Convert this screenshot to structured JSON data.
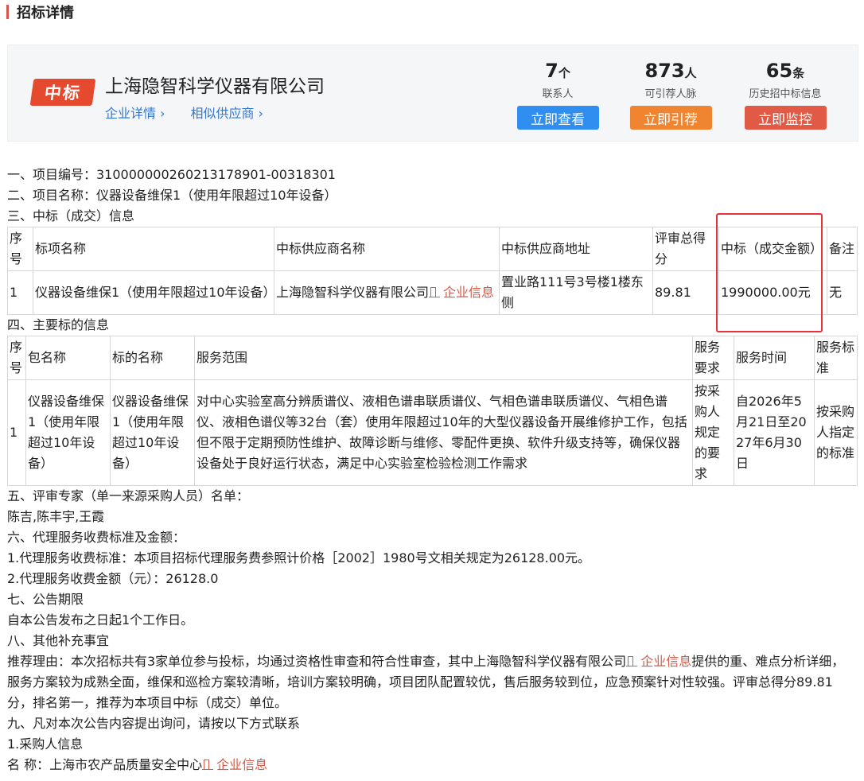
{
  "header": {
    "title": "招标详情"
  },
  "card": {
    "badge": "中标",
    "company": "上海隐智科学仪器有限公司",
    "links": [
      "企业详情 ›",
      "相似供应商 ›"
    ],
    "stats": [
      {
        "value": "7",
        "unit": "个",
        "label": "联系人",
        "button": "立即查看",
        "color": "#2f8ef0"
      },
      {
        "value": "873",
        "unit": "人",
        "label": "可引荐人脉",
        "button": "立即引荐",
        "color": "#ef8431"
      },
      {
        "value": "65",
        "unit": "条",
        "label": "历史招中标信息",
        "button": "立即监控",
        "color": "#e05a45"
      }
    ]
  },
  "body": {
    "s1": "一、项目编号：310000000260213178901-00318301",
    "s2": "二、项目名称：仪器设备维保1（使用年限超过10年设备）",
    "s3": "三、中标（成交）信息",
    "t1": {
      "headers": [
        "序号",
        "标项名称",
        "中标供应商名称",
        "中标供应商地址",
        "评审总得分",
        "中标（成交金额）",
        "备注"
      ],
      "row": {
        "no": "1",
        "name": "仪器设备维保1（使用年限超过10年设备）",
        "supplier": "上海隐智科学仪器有限公司",
        "supplier_link": "企业信息",
        "address": "置业路111号3号楼1楼东侧",
        "score": "89.81",
        "amount": "1990000.00元",
        "remark": "无"
      }
    },
    "s4": "四、主要标的信息",
    "t2": {
      "headers": [
        "序号",
        "包名称",
        "标的名称",
        "服务范围",
        "服务要求",
        "服务时间",
        "服务标准"
      ],
      "row": {
        "no": "1",
        "pkg": "仪器设备维保1（使用年限超过10年设备）",
        "target": "仪器设备维保1（使用年限超过10年设备）",
        "scope": "对中心实验室高分辨质谱仪、液相色谱串联质谱仪、气相色谱串联质谱仪、气相色谱仪、液相色谱仪等32台（套）使用年限超过10年的大型仪器设备开展维修护工作，包括但不限于定期预防性维护、故障诊断与维修、零配件更换、软件升级支持等，确保仪器设备处于良好运行状态，满足中心实验室检验检测工作需求",
        "req": "按采购人规定的要求",
        "time": "自2026年5月21日至2027年6月30日",
        "std": "按采购人指定的标准"
      }
    },
    "s5": "五、评审专家（单一来源采购人员）名单：",
    "experts": "陈吉,陈丰宇,王霞",
    "s6": "六、代理服务收费标准及金额：",
    "fee1": "1.代理服务收费标准：本项目招标代理服务费参照计价格［2002］1980号文相关规定为26128.00元。",
    "fee2": "2.代理服务收费金额（元）：26128.0",
    "s7": "七、公告期限",
    "period": "自本公告发布之日起1个工作日。",
    "s8": "八、其他补充事宜",
    "reason_pre": "推荐理由：本次招标共有3家单位参与投标，均通过资格性审查和符合性审查，其中上海隐智科学仪器有限公司",
    "reason_link": "企业信息",
    "reason_post": "提供的重、难点分析详细，服务方案较为成熟全面，维保和巡检方案较清晰，培训方案较明确，项目团队配置较优，售后服务较到位，应急预案针对性较强。评审总得分89.81分，排名第一，推荐为本项目中标（成交）单位。",
    "s9": "九、凡对本次公告内容提出询问，请按以下方式联系",
    "buyer_title": "1.采购人信息",
    "buyer_name": "名 称：上海市农产品质量安全中心",
    "buyer_link": "企业信息"
  }
}
